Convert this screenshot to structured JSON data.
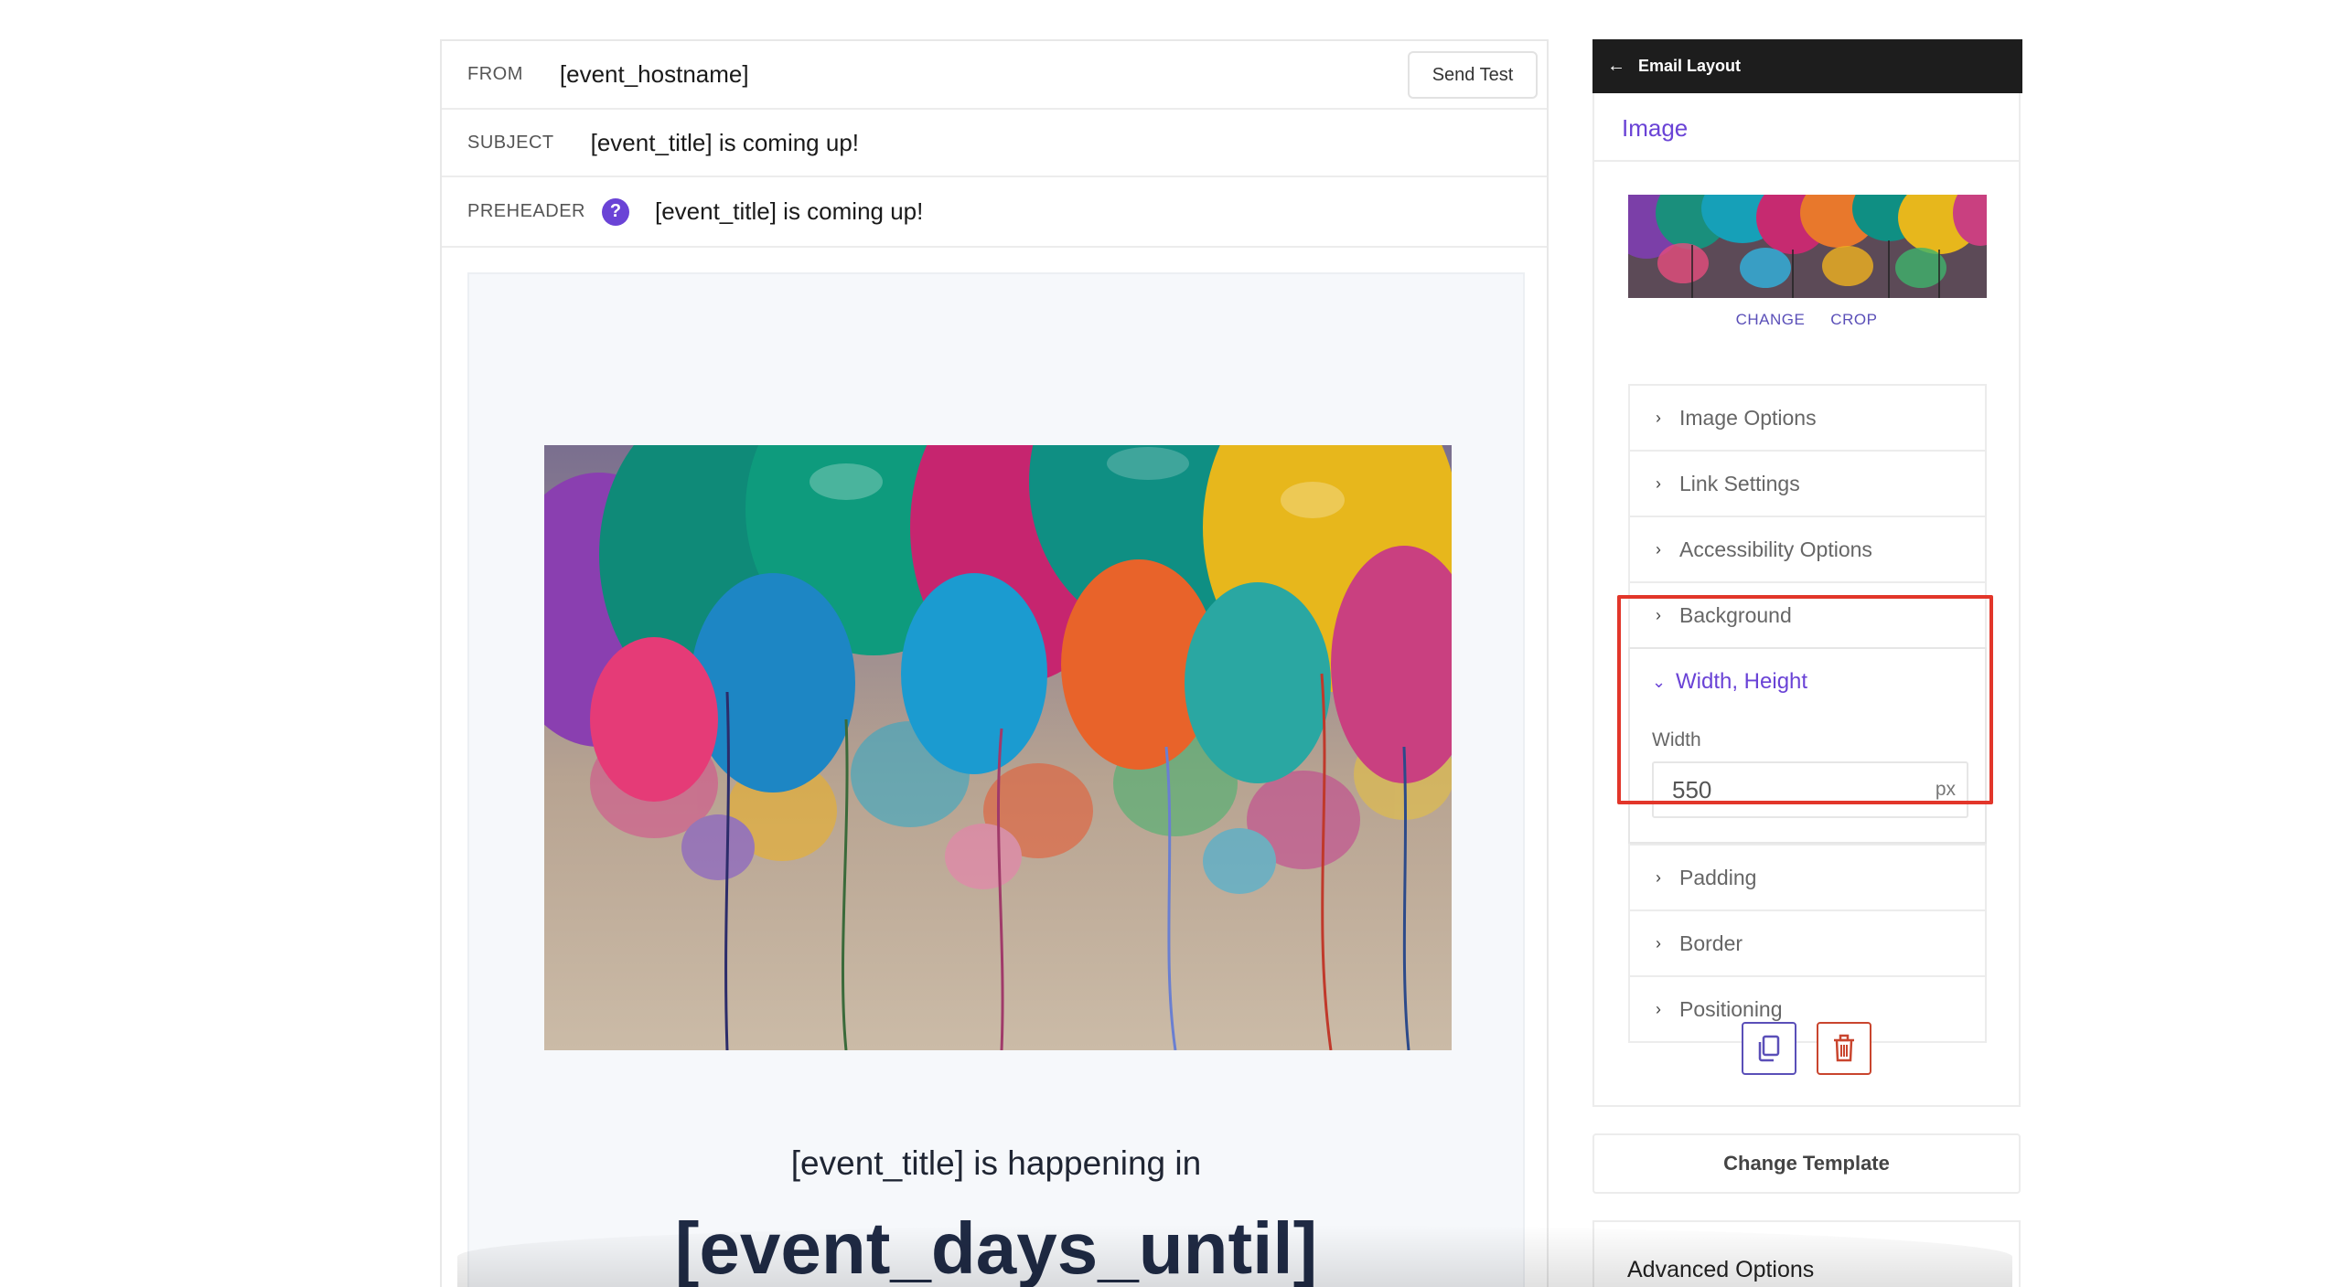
{
  "email": {
    "from_label": "FROM",
    "from_value": "[event_hostname]",
    "send_test_label": "Send Test",
    "subject_label": "SUBJECT",
    "subject_value": "[event_title] is coming up!",
    "preheader_label": "PREHEADER",
    "preheader_help": "?",
    "preheader_value": "[event_title] is coming up!",
    "body_line": "[event_title] is happening in",
    "body_big": "[event_days_until]"
  },
  "panel": {
    "back_icon": "←",
    "title": "Email Layout",
    "section_title": "Image",
    "change_label": "CHANGE",
    "crop_label": "CROP",
    "collapsed_before": [
      {
        "label": "Image Options"
      },
      {
        "label": "Link Settings"
      },
      {
        "label": "Accessibility Options"
      },
      {
        "label": "Background"
      }
    ],
    "open_item": {
      "title": "Width, Height",
      "width_label": "Width",
      "width_value": "550",
      "width_unit": "px"
    },
    "collapsed_after": [
      {
        "label": "Padding"
      },
      {
        "label": "Border"
      },
      {
        "label": "Positioning"
      }
    ]
  },
  "change_template_label": "Change Template",
  "advanced_options_label": "Advanced Options",
  "colors": {
    "accent": "#6a43d6",
    "highlight": "#e2362a",
    "delete": "#c9452e",
    "topbar": "#1d1d1d"
  }
}
